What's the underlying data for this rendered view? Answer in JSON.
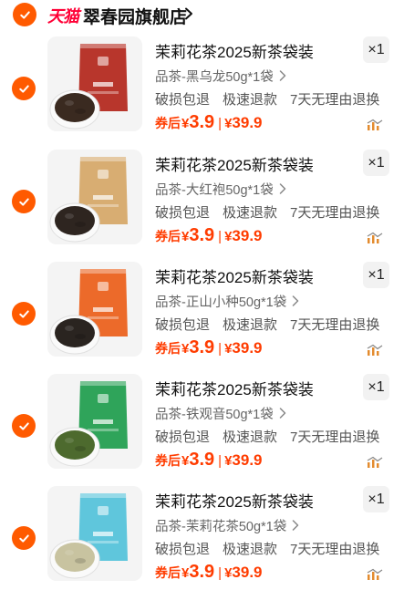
{
  "store": {
    "platform_logo": "天猫",
    "name": "翠春园旗舰店",
    "check_icon": "checkmark-icon",
    "accent_color": "#ff5a00"
  },
  "items": [
    {
      "title": "茉莉花茶2025新茶袋装",
      "qty": "×1",
      "sku": "品茶-黑乌龙50g*1袋",
      "services": [
        "破损包退",
        "极速退款",
        "7天无理由退换"
      ],
      "coupon_label": "券后",
      "currency": "¥",
      "coupon_price": "3.9",
      "price": "39.9",
      "bag_color": "#b8362c",
      "tea_color": "#3a2a20"
    },
    {
      "title": "茉莉花茶2025新茶袋装",
      "qty": "×1",
      "sku": "品茶-大红袍50g*1袋",
      "services": [
        "破损包退",
        "极速退款",
        "7天无理由退换"
      ],
      "coupon_label": "券后",
      "currency": "¥",
      "coupon_price": "3.9",
      "price": "39.9",
      "bag_color": "#d8ad72",
      "tea_color": "#2e2520"
    },
    {
      "title": "茉莉花茶2025新茶袋装",
      "qty": "×1",
      "sku": "品茶-正山小种50g*1袋",
      "services": [
        "破损包退",
        "极速退款",
        "7天无理由退换"
      ],
      "coupon_label": "券后",
      "currency": "¥",
      "coupon_price": "3.9",
      "price": "39.9",
      "bag_color": "#ec6a2a",
      "tea_color": "#2a2420"
    },
    {
      "title": "茉莉花茶2025新茶袋装",
      "qty": "×1",
      "sku": "品茶-铁观音50g*1袋",
      "services": [
        "破损包退",
        "极速退款",
        "7天无理由退换"
      ],
      "coupon_label": "券后",
      "currency": "¥",
      "coupon_price": "3.9",
      "price": "39.9",
      "bag_color": "#2fa45a",
      "tea_color": "#4d6a2e"
    },
    {
      "title": "茉莉花茶2025新茶袋装",
      "qty": "×1",
      "sku": "品茶-茉莉花茶50g*1袋",
      "services": [
        "破损包退",
        "极速退款",
        "7天无理由退换"
      ],
      "coupon_label": "券后",
      "currency": "¥",
      "coupon_price": "3.9",
      "price": "39.9",
      "bag_color": "#5fc6dc",
      "tea_color": "#c8c3a0"
    }
  ]
}
